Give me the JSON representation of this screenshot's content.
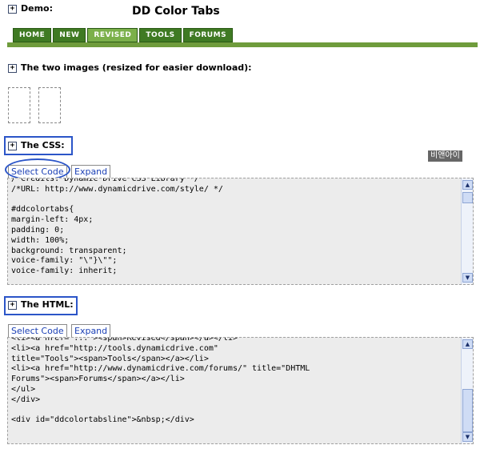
{
  "demo": {
    "label": "Demo:",
    "title": "DD Color Tabs"
  },
  "tabs": [
    {
      "label": "HOME"
    },
    {
      "label": "NEW"
    },
    {
      "label": "REVISED"
    },
    {
      "label": "TOOLS"
    },
    {
      "label": "FORUMS"
    }
  ],
  "images_section": {
    "label": "The two images (resized for easier download):"
  },
  "css_section": {
    "label": "The CSS:",
    "select_code": "Select Code",
    "expand": "Expand",
    "code": "/*Credits: Dynamic Drive CSS Library */\n/*URL: http://www.dynamicdrive.com/style/ */\n\n#ddcolortabs{\nmargin-left: 4px;\npadding: 0;\nwidth: 100%;\nbackground: transparent;\nvoice-family: \"\\\"}\\\"\";\nvoice-family: inherit;"
  },
  "html_section": {
    "label": "The HTML:",
    "select_code": "Select Code",
    "expand": "Expand",
    "code": "<li><a href=\"...\"><span>Revised</span></a></li>\n<li><a href=\"http://tools.dynamicdrive.com\"\ntitle=\"Tools\"><span>Tools</span></a></li>\n<li><a href=\"http://www.dynamicdrive.com/forums/\" title=\"DHTML\nForums\"><span>Forums</span></a></li>\n</ul>\n</div>\n\n<div id=\"ddcolortabsline\">&nbsp;</div>"
  },
  "badge": {
    "text": "비앤아이"
  },
  "colors": {
    "tab_green": "#3f7a23",
    "tab_active": "#7bb04a",
    "highlight_blue": "#2b55c8",
    "code_bg": "#ececec"
  }
}
